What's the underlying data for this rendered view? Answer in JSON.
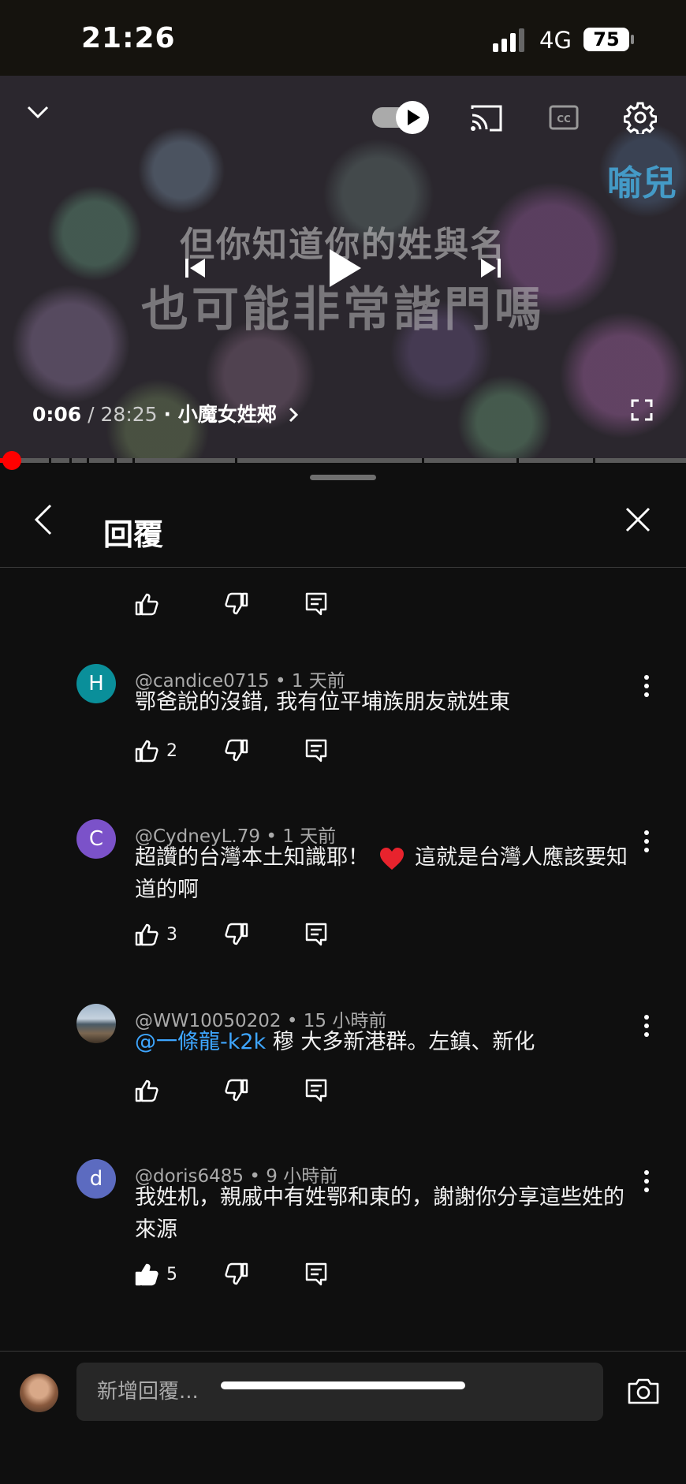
{
  "status_bar": {
    "time": "21:26",
    "network": "4G",
    "battery": "75"
  },
  "video": {
    "lyric_line1": "但你知道你的姓與名",
    "lyric_line2": "也可能非常諧門嗎",
    "watermark": "喻兒",
    "current_time": "0:06",
    "total_time": "/ 28:25",
    "chapter": "· 小魔女姓郟",
    "progress": 0.004
  },
  "panel": {
    "title": "回覆"
  },
  "comments": [
    {
      "author": "@candice0715",
      "age": "1 天前",
      "text": "鄂爸說的沒錯, 我有位平埔族朋友就姓東",
      "likes": "2",
      "avatar_letter": "H",
      "avatar_color": "#0a8f9a"
    },
    {
      "author": "@CydneyL.79",
      "age": "1 天前",
      "text_before": "超讚的台灣本土知識耶！",
      "text_after": "這就是台灣人應該要知道的啊",
      "likes": "3",
      "avatar_letter": "C",
      "avatar_color": "#7b52c9"
    },
    {
      "author": "@WW10050202",
      "age": "15 小時前",
      "mention": "@一條龍-k2k",
      "text": " 穆 大多新港群。左鎮、新化",
      "likes": ""
    },
    {
      "author": "@doris6485",
      "age": "9 小時前",
      "text": "我姓机，親戚中有姓鄂和東的，謝謝你分享這些姓的來源",
      "likes": "5",
      "avatar_letter": "d",
      "avatar_color": "#5c6bc0"
    }
  ],
  "reply_box": {
    "placeholder": "新增回覆..."
  },
  "icons": {
    "collapse": "chevron-down-icon",
    "autoplay": "autoplay-toggle-icon",
    "cast": "cast-icon",
    "captions": "captions-icon",
    "settings": "gear-icon",
    "fullscreen": "fullscreen-icon",
    "camera": "camera-icon"
  },
  "colors": {
    "accent": "#ff0000",
    "mention": "#3ea6ff"
  }
}
